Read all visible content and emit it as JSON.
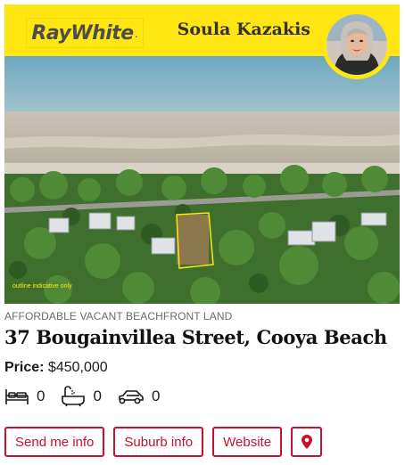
{
  "brand": {
    "logo_text": "RayWhite",
    "logo_dot": ".",
    "agent_name": "Soula Kazakis"
  },
  "listing": {
    "photo_caption": "outline indicative only",
    "tagline": "AFFORDABLE VACANT BEACHFRONT LAND",
    "address": "37 Bougainvillea Street, Cooya Beach",
    "price_label": "Price:",
    "price_value": "$450,000"
  },
  "features": {
    "bedrooms": "0",
    "bathrooms": "0",
    "car_spaces": "0"
  },
  "actions": {
    "send_info": "Send me info",
    "suburb_info": "Suburb info",
    "website": "Website"
  },
  "colors": {
    "brand_yellow": "#ffe512",
    "action_red": "#c8102e"
  },
  "icons": [
    "bed-icon",
    "bath-icon",
    "car-icon",
    "map-pin-icon"
  ]
}
